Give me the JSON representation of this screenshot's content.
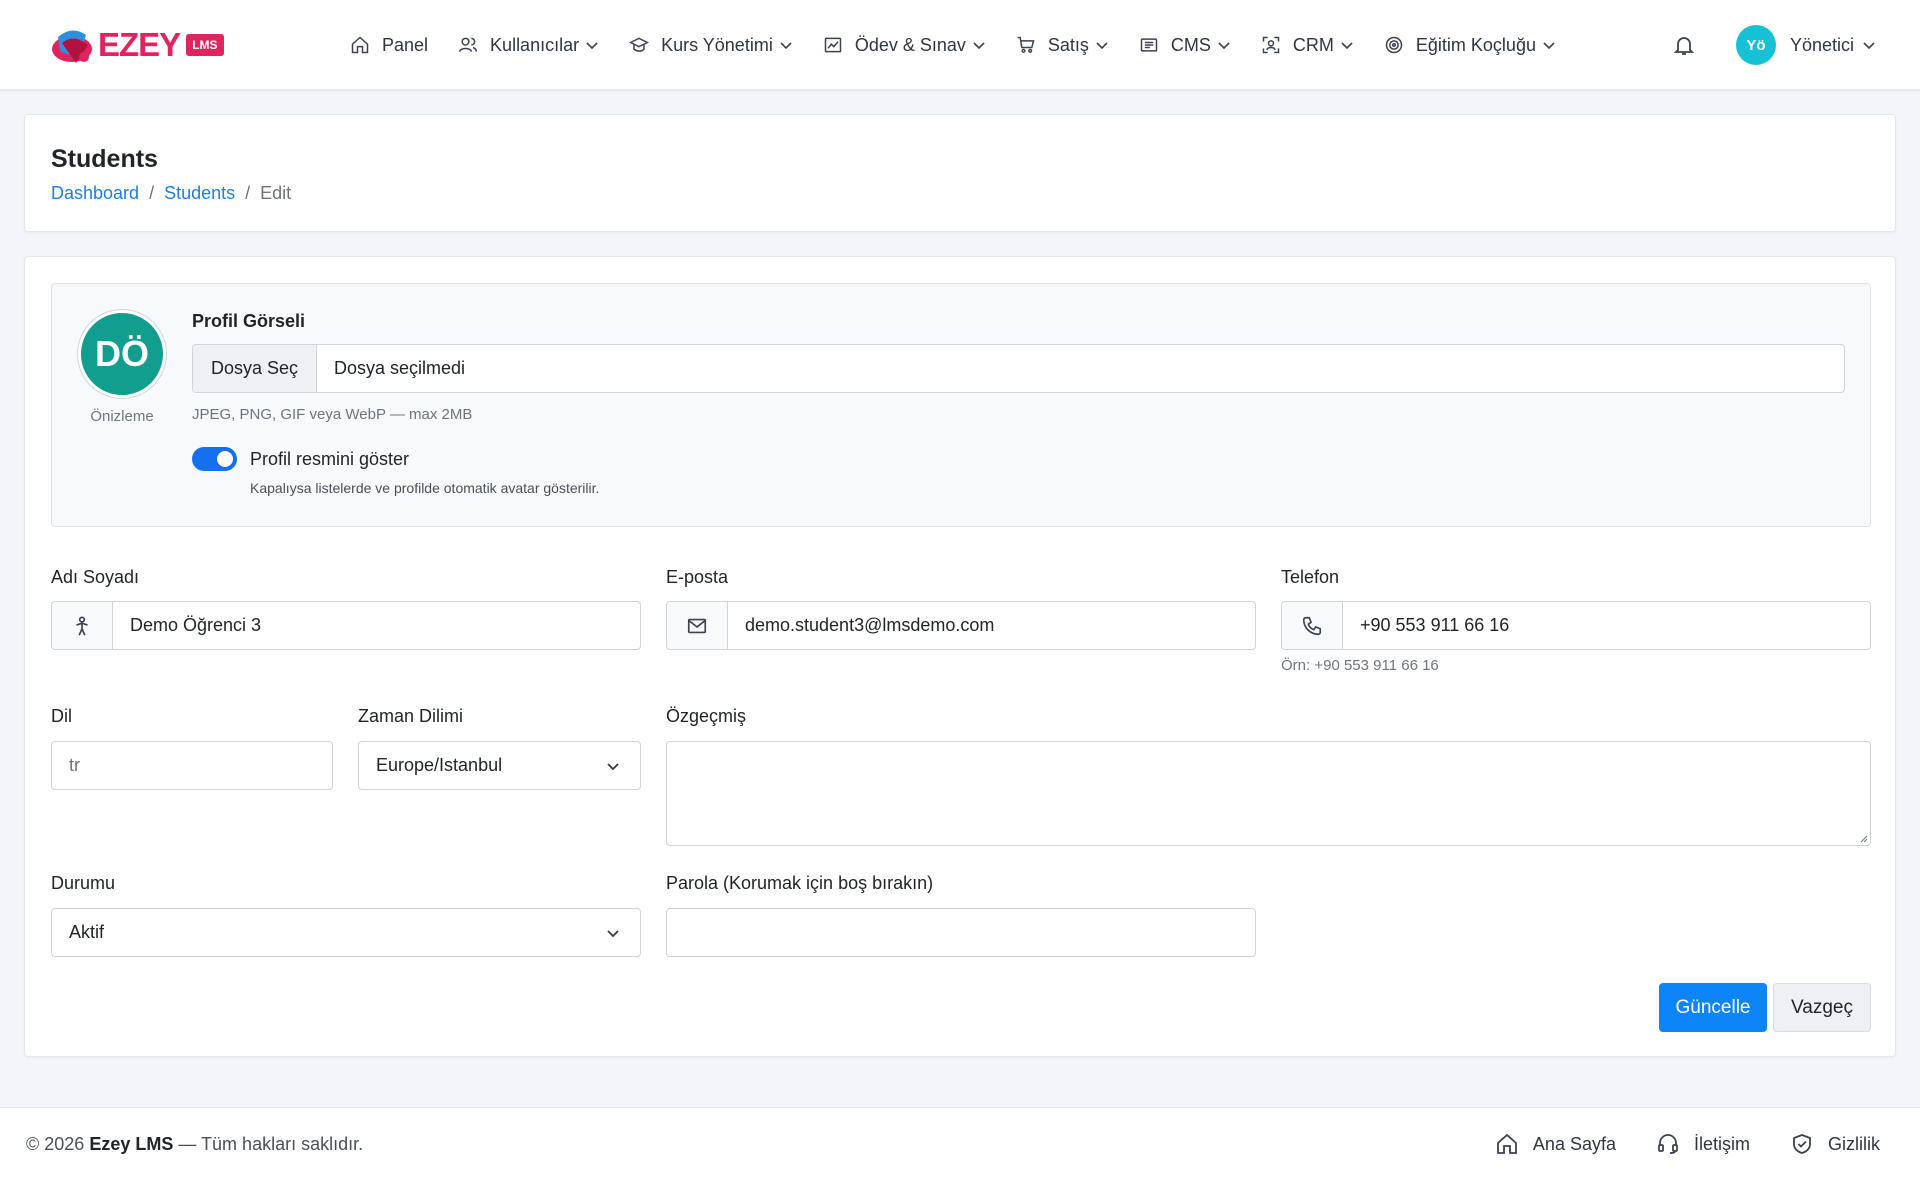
{
  "brand": {
    "logo_text": "EZEY",
    "logo_badge": "LMS",
    "colors": {
      "brand": "#e0245e",
      "primary": "#0d84f7",
      "avatar": "#119e8e"
    }
  },
  "nav": {
    "items": [
      {
        "label": "Panel",
        "icon": "home-icon",
        "dropdown": false
      },
      {
        "label": "Kullanıcılar",
        "icon": "users-icon",
        "dropdown": true
      },
      {
        "label": "Kurs Yönetimi",
        "icon": "graduation-cap-icon",
        "dropdown": true
      },
      {
        "label": "Ödev & Sınav",
        "icon": "image-chart-icon",
        "dropdown": true
      },
      {
        "label": "Satış",
        "icon": "cart-icon",
        "dropdown": true
      },
      {
        "label": "CMS",
        "icon": "newspaper-icon",
        "dropdown": true
      },
      {
        "label": "CRM",
        "icon": "scan-user-icon",
        "dropdown": true
      },
      {
        "label": "Eğitim Koçluğu",
        "icon": "target-icon",
        "dropdown": true
      }
    ],
    "user": {
      "initials": "Yö",
      "name": "Yönetici"
    }
  },
  "page": {
    "title": "Students",
    "breadcrumb": [
      "Dashboard",
      "Students",
      "Edit"
    ]
  },
  "profile": {
    "avatar_initials": "DÖ",
    "preview_label": "Önizleme",
    "image_label": "Profil Görseli",
    "file_button": "Dosya Seç",
    "file_status": "Dosya seçilmedi",
    "file_help": "JPEG, PNG, GIF veya WebP — max 2MB",
    "toggle_label": "Profil resmini göster",
    "toggle_on": true,
    "toggle_help": "Kapalıysa listelerde ve profilde otomatik avatar gösterilir."
  },
  "form": {
    "name": {
      "label": "Adı Soyadı",
      "value": "Demo Öğrenci 3"
    },
    "email": {
      "label": "E-posta",
      "value": "demo.student3@lmsdemo.com"
    },
    "phone": {
      "label": "Telefon",
      "value": "+90 553 911 66 16",
      "help": "Örn: +90 553 911 66 16"
    },
    "language": {
      "label": "Dil",
      "placeholder": "tr"
    },
    "timezone": {
      "label": "Zaman Dilimi",
      "value": "Europe/Istanbul"
    },
    "bio": {
      "label": "Özgeçmiş",
      "value": ""
    },
    "status": {
      "label": "Durumu",
      "value": "Aktif"
    },
    "password": {
      "label": "Parola (Korumak için boş bırakın)",
      "value": ""
    },
    "update_button": "Güncelle",
    "cancel_button": "Vazgeç"
  },
  "footer": {
    "copyright_prefix": "© 2026",
    "brand": "Ezey LMS",
    "copyright_suffix": "— Tüm hakları saklıdır.",
    "links": [
      {
        "label": "Ana Sayfa",
        "icon": "home-icon"
      },
      {
        "label": "İletişim",
        "icon": "headset-icon"
      },
      {
        "label": "Gizlilik",
        "icon": "shield-check-icon"
      }
    ]
  }
}
